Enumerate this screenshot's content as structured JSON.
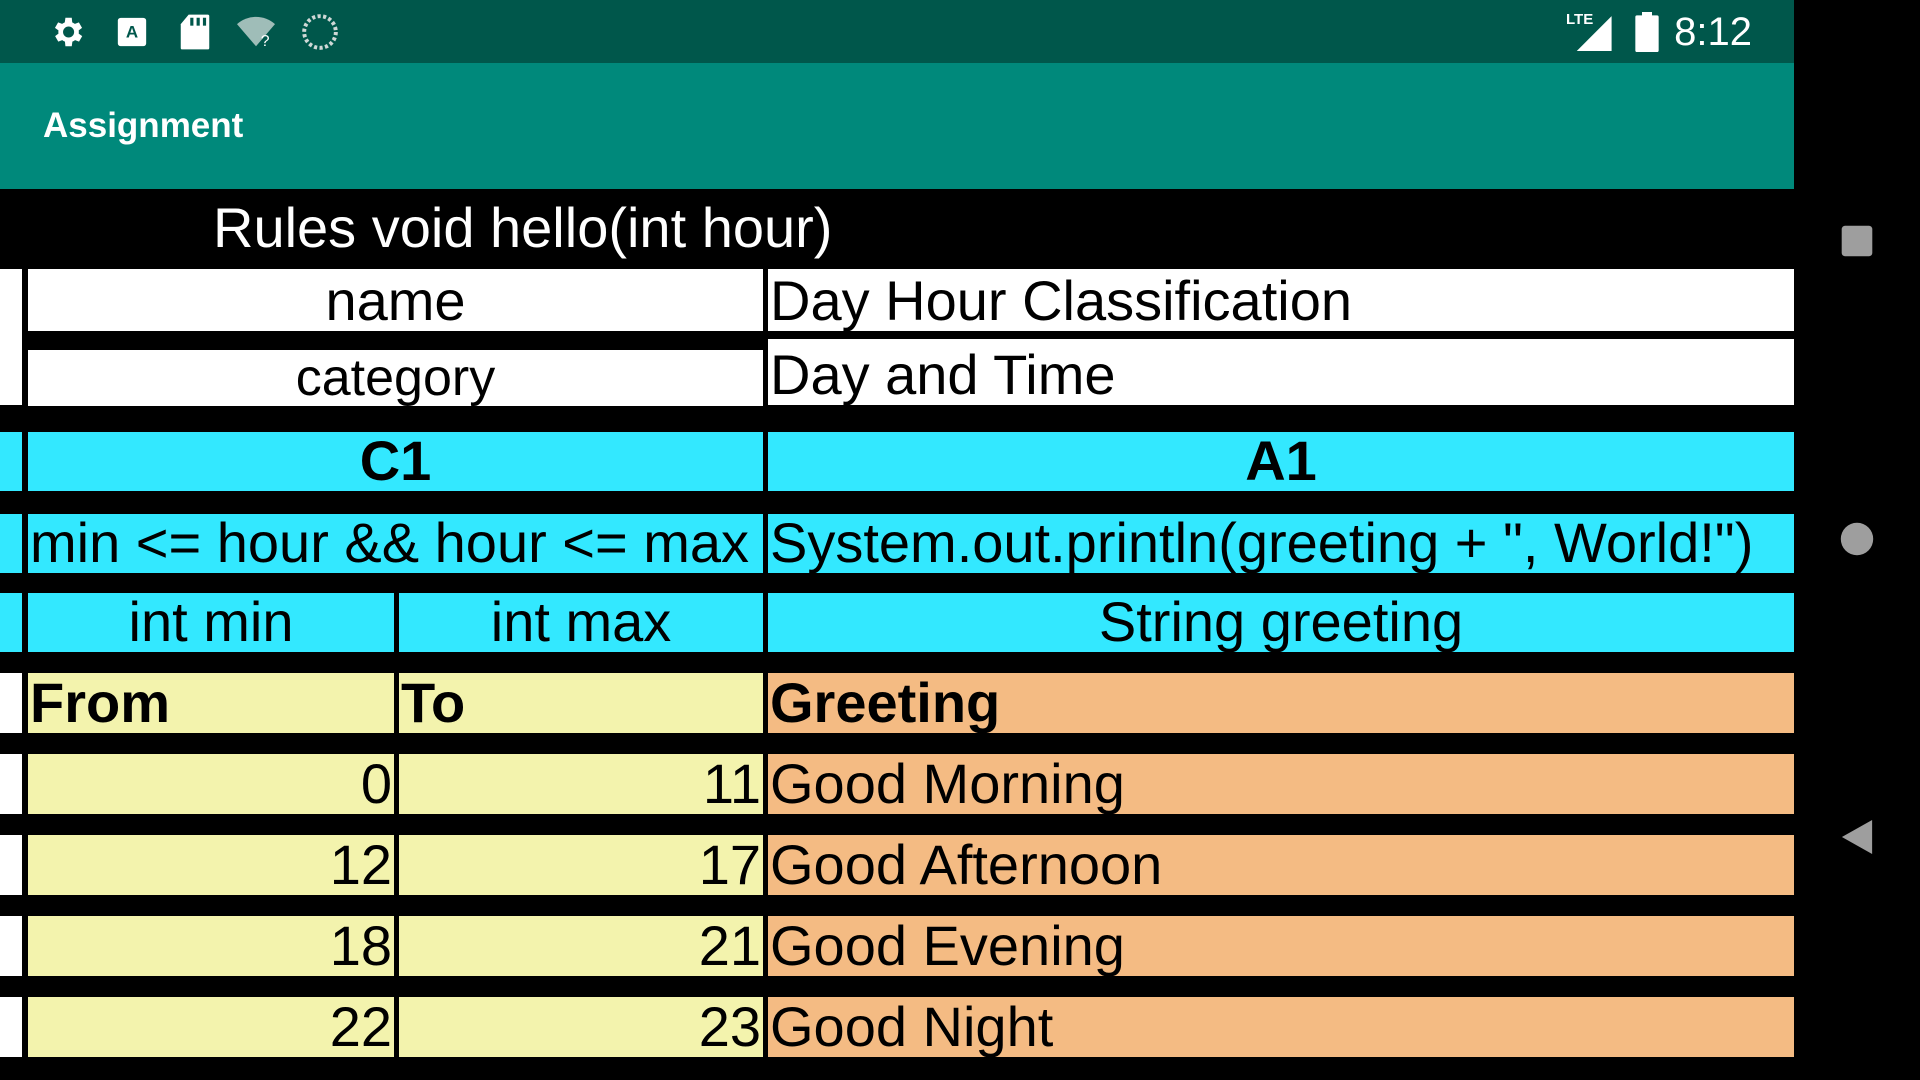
{
  "status_bar": {
    "time": "8:12",
    "network_label": "LTE",
    "icons": [
      "gear-icon",
      "keyboard-a-icon",
      "sd-card-icon",
      "wifi-unknown-icon",
      "sync-circle-icon",
      "signal-icon",
      "battery-icon"
    ]
  },
  "app_bar": {
    "title": "Assignment"
  },
  "rules_table": {
    "title": "Rules void hello(int hour)",
    "meta": [
      {
        "key": "name",
        "value": "Day Hour Classification"
      },
      {
        "key": "category",
        "value": "Day and Time"
      }
    ],
    "header": {
      "condition_id": "C1",
      "action_id": "A1",
      "condition_expr": "min <= hour && hour <= max",
      "action_expr": "System.out.println(greeting + \", World!\")",
      "param_min": "int min",
      "param_max": "int max",
      "param_greeting": "String greeting",
      "label_from": "From",
      "label_to": "To",
      "label_greeting": "Greeting"
    },
    "rows": [
      {
        "from": "0",
        "to": "11",
        "greeting": "Good Morning"
      },
      {
        "from": "12",
        "to": "17",
        "greeting": "Good Afternoon"
      },
      {
        "from": "18",
        "to": "21",
        "greeting": "Good Evening"
      },
      {
        "from": "22",
        "to": "23",
        "greeting": "Good Night"
      }
    ]
  },
  "colors": {
    "status_bar": "#00574b",
    "app_bar": "#00897b",
    "header_cyan": "#33e8ff",
    "condition_yellow": "#f3f3ad",
    "action_orange": "#f4bb83"
  }
}
